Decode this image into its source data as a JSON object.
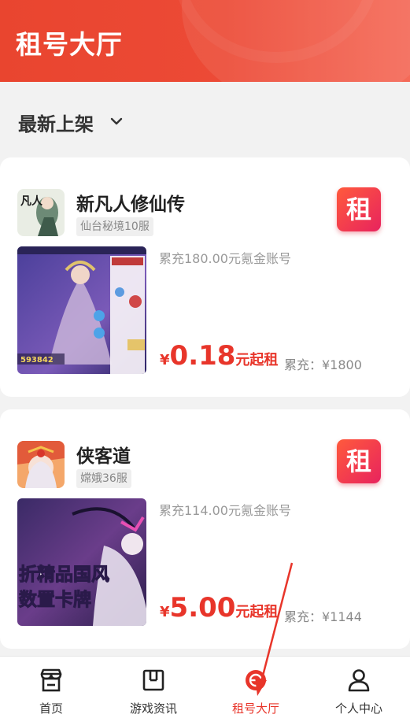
{
  "header": {
    "title": "租号大厅"
  },
  "sort": {
    "label": "最新上架"
  },
  "listings": [
    {
      "game_name": "新凡人修仙传",
      "server": "仙台秘境10服",
      "badge": "租",
      "description": "累充180.00元氪金账号",
      "currency": "¥",
      "price": "0.18",
      "price_suffix": "元起租",
      "total_recharge": "累充：¥1800",
      "icon_text": "凡人",
      "cover_text": "593842"
    },
    {
      "game_name": "侠客道",
      "server": "嫦娥36服",
      "badge": "租",
      "description": "累充114.00元氪金账号",
      "currency": "¥",
      "price": "5.00",
      "price_suffix": "元起租",
      "total_recharge": "累充：¥1144",
      "cover_line1": "折精品国风",
      "cover_line2": "数置卡牌"
    }
  ],
  "tabbar": {
    "items": [
      {
        "label": "首页",
        "icon": "store-icon"
      },
      {
        "label": "游戏资讯",
        "icon": "news-icon"
      },
      {
        "label": "租号大厅",
        "icon": "rent-hall-icon",
        "active": true
      },
      {
        "label": "个人中心",
        "icon": "user-icon"
      }
    ]
  },
  "colors": {
    "accent": "#e8352a",
    "header": "#ec4a36",
    "badge_from": "#ff5a3c",
    "badge_to": "#e8235e"
  }
}
